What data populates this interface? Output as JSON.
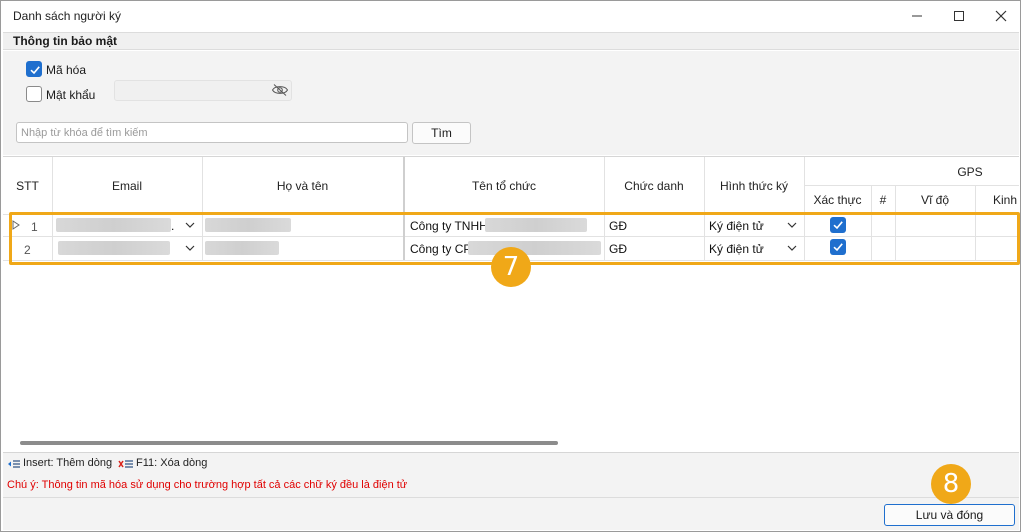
{
  "window": {
    "title": "Danh sách người ký",
    "controls": [
      "minimize-icon",
      "maximize-icon",
      "close-icon"
    ]
  },
  "security": {
    "section_title": "Thông tin bảo mật",
    "encrypt_label": "Mã hóa",
    "encrypt_checked": true,
    "password_label": "Mật khẩu",
    "password_checked": false,
    "password_value": ""
  },
  "search": {
    "placeholder": "Nhập từ khóa để tìm kiếm",
    "button_label": "Tìm"
  },
  "grid": {
    "columns": {
      "stt": "STT",
      "email": "Email",
      "fullname": "Họ và tên",
      "org": "Tên tổ chức",
      "position": "Chức danh",
      "sign_type": "Hình thức ký",
      "gps": "GPS",
      "verify": "Xác thực",
      "hash": "#",
      "lat": "Vĩ độ",
      "lng": "Kinh"
    },
    "rows": [
      {
        "stt": "1",
        "email_suffix": ".",
        "org": "Công ty TNHH",
        "position": "GĐ",
        "sign_type": "Ký điện tử",
        "verified": true
      },
      {
        "stt": "2",
        "email_suffix": "",
        "org": "Công ty CP",
        "position": "GĐ",
        "sign_type": "Ký điện tử",
        "verified": true
      }
    ]
  },
  "annotations": {
    "step_rows": "7",
    "step_save": "8",
    "accent_color": "#f0a818"
  },
  "footer": {
    "insert_hint": "Insert: Thêm dòng",
    "delete_hint": "F11: Xóa dòng",
    "note": "Chú ý: Thông tin mã hóa sử dụng cho trường hợp tất cả các chữ ký đều là điện tử",
    "save_label": "Lưu và đóng"
  }
}
